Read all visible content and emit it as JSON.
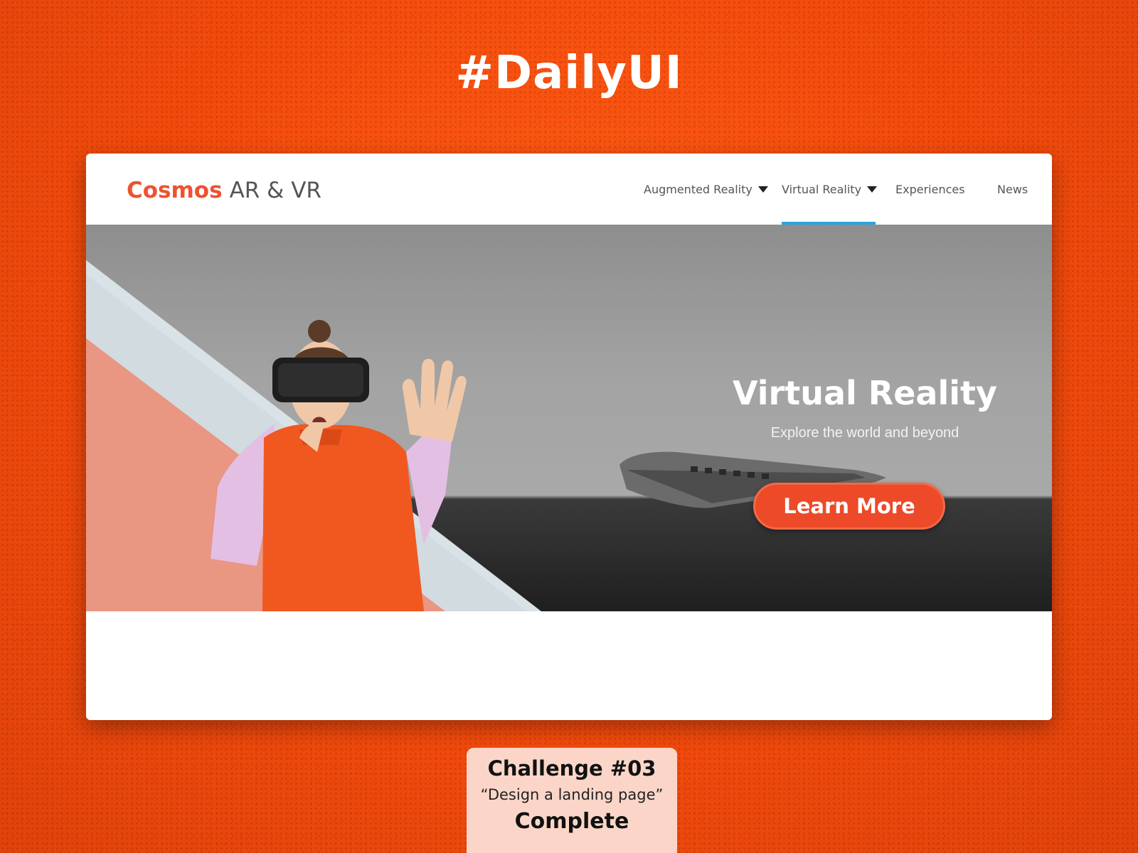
{
  "heading": "#DailyUI",
  "nav": {
    "logo_brand": "Cosmos",
    "logo_sub": "AR & VR",
    "items": [
      {
        "label": "Augmented Reality"
      },
      {
        "label": "Virtual Reality",
        "active": true
      },
      {
        "label": "Experiences"
      },
      {
        "label": "News"
      }
    ]
  },
  "hero": {
    "title": "Virtual Reality",
    "subtitle": "Explore the world and beyond",
    "cta_label": "Learn More"
  },
  "footer": {
    "title": "Challenge #03",
    "quote": "“Design a landing page”",
    "status": "Complete"
  },
  "colors": {
    "background": "#f24a0c",
    "accent": "#ec4a28",
    "active_underline": "#2aa5dc",
    "salmon_shape": "#e99683",
    "pale_shape": "#d9e2e6"
  }
}
